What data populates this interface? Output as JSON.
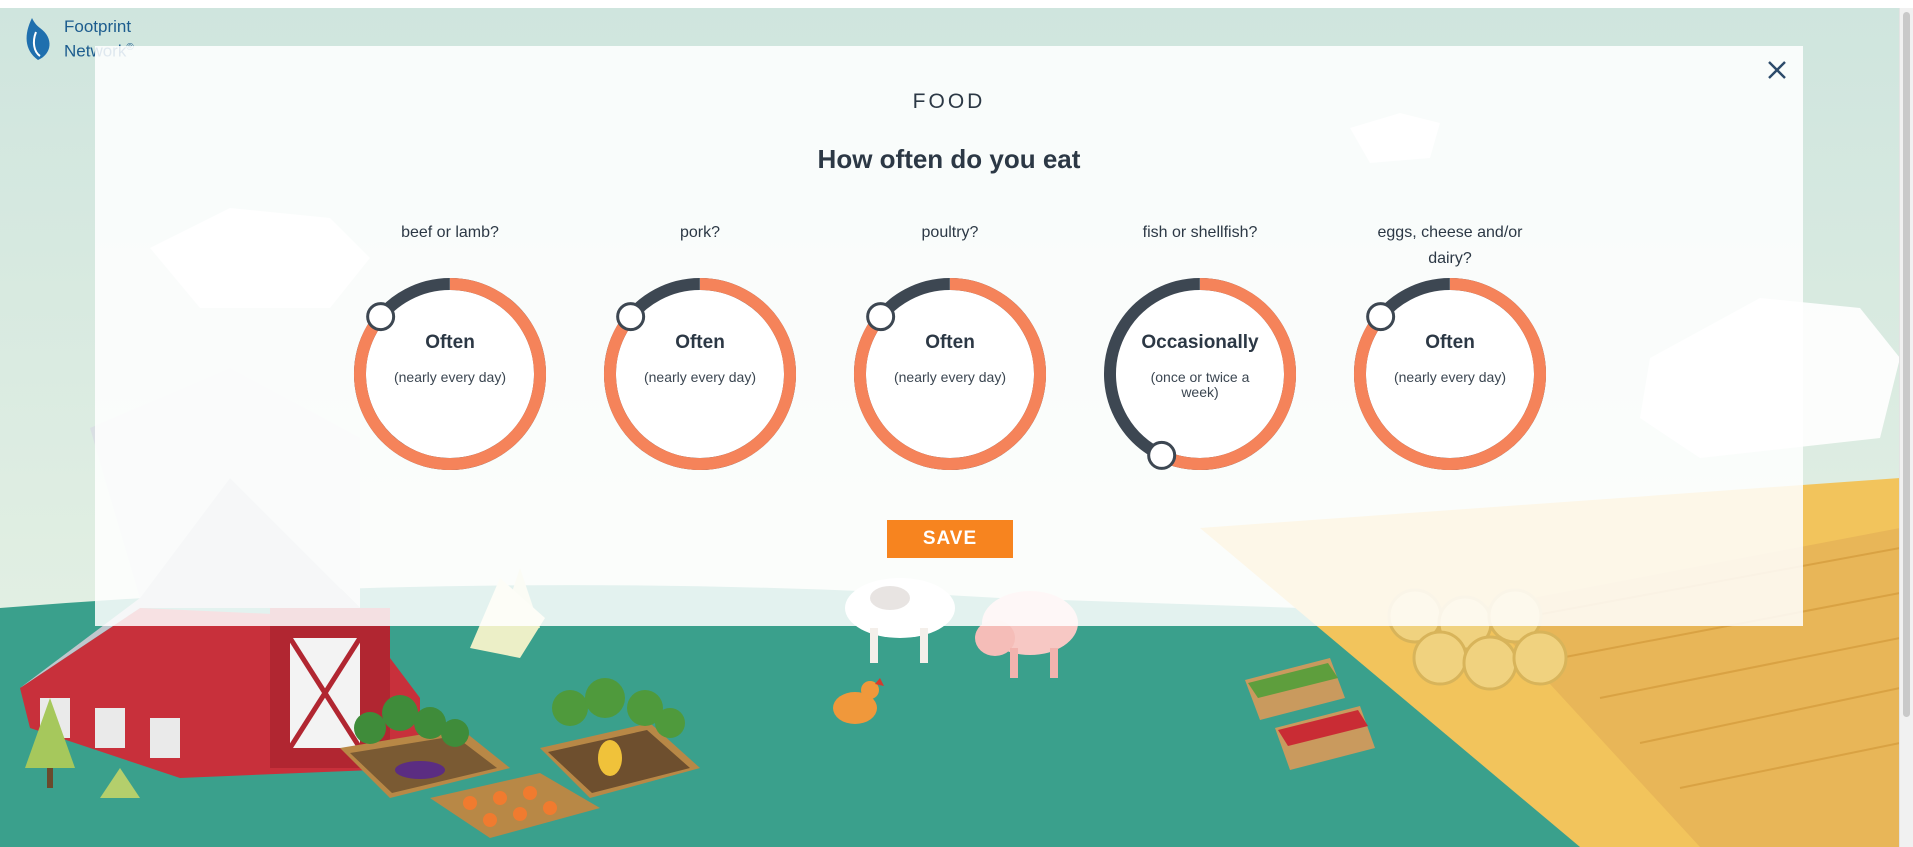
{
  "logo": {
    "line1": "Footprint",
    "line2": "Network",
    "reg": "®"
  },
  "modal": {
    "section_title": "FOOD",
    "question": "How often do you eat",
    "close_icon": "close-icon",
    "save_label": "SAVE",
    "dials": [
      {
        "label": "beef or lamb?",
        "value": "Often",
        "sub": "(nearly every day)",
        "level": 0.86
      },
      {
        "label": "pork?",
        "value": "Often",
        "sub": "(nearly every day)",
        "level": 0.86
      },
      {
        "label": "poultry?",
        "value": "Often",
        "sub": "(nearly every day)",
        "level": 0.86
      },
      {
        "label": "fish or shellfish?",
        "value": "Occasionally",
        "sub": "(once or twice a week)",
        "level": 0.57
      },
      {
        "label": "eggs, cheese and/or dairy?",
        "value": "Often",
        "sub": "(nearly every day)",
        "level": 0.86
      }
    ]
  },
  "colors": {
    "accent": "#f7841f",
    "ring_dark": "#3d4752",
    "ring_orange": "#f5835a",
    "text": "#2c3845"
  }
}
